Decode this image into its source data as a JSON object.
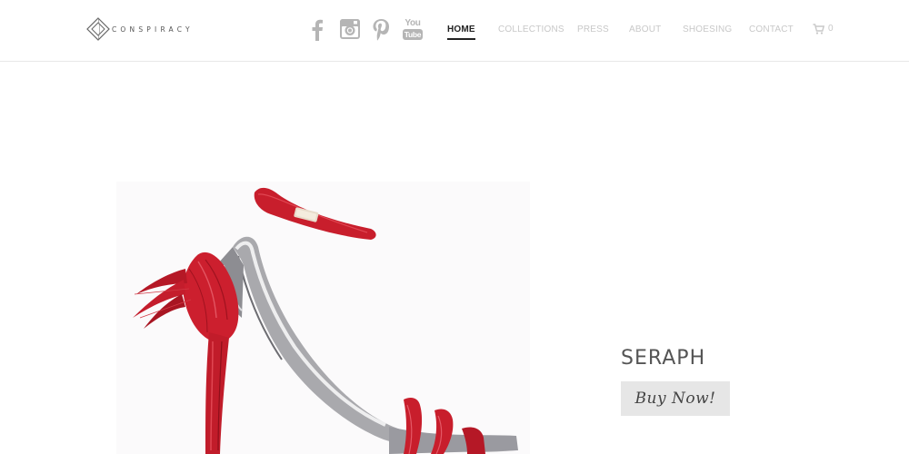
{
  "brand": {
    "name": "CONSPIRACY"
  },
  "social": [
    {
      "name": "facebook-icon",
      "label": "f"
    },
    {
      "name": "instagram-icon"
    },
    {
      "name": "pinterest-icon"
    },
    {
      "name": "youtube-icon",
      "top": "You",
      "bottom": "Tube"
    }
  ],
  "nav": {
    "items": [
      {
        "label": "HOME",
        "active": true
      },
      {
        "label": "COLLECTIONS"
      },
      {
        "label": "PRESS"
      },
      {
        "label": "ABOUT"
      },
      {
        "label": "SHOESING"
      },
      {
        "label": "CONTACT"
      }
    ],
    "cart_count": "0"
  },
  "product": {
    "name": "SERAPH",
    "buy_label": "Buy Now!"
  },
  "colors": {
    "accent": "#d42a35",
    "nav_active": "#222222",
    "nav_inactive": "#c8c8c8",
    "icon_gray": "#b5b5b5",
    "button_bg": "#e6e6e6"
  }
}
